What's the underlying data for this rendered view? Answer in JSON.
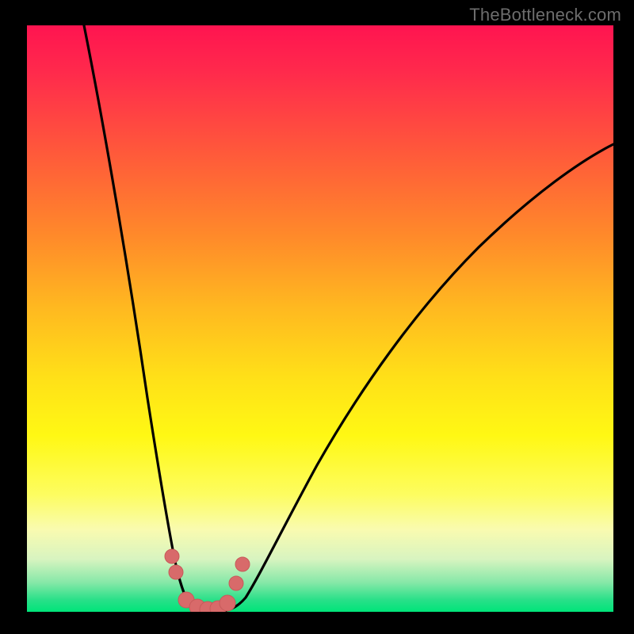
{
  "watermark": {
    "text": "TheBottleneck.com"
  },
  "colors": {
    "gradient_top": "#ff1450",
    "gradient_mid": "#ffe018",
    "gradient_bottom": "#00e47a",
    "curve_stroke": "#000000",
    "marker_fill": "#d86a6a",
    "marker_stroke": "#c75a5a"
  },
  "chart_data": {
    "type": "line",
    "title": "",
    "xlabel": "",
    "ylabel": "",
    "xlim": [
      0,
      100
    ],
    "ylim": [
      0,
      100
    ],
    "grid": false,
    "legend": false,
    "note": "Approximate V-shaped bottleneck curve. y is the vertical position (0 at bottom / green band, 100 at top / red). Minimum around x ≈ 27–34 where y ≈ 0.",
    "series": [
      {
        "name": "curve",
        "x": [
          10,
          12,
          14,
          16,
          18,
          20,
          22,
          24,
          26,
          27,
          30,
          32,
          34,
          36,
          40,
          45,
          50,
          55,
          60,
          65,
          70,
          75,
          80,
          85,
          90,
          95,
          100
        ],
        "y": [
          100,
          88,
          76,
          64,
          52,
          40,
          28,
          16,
          6,
          2,
          0,
          0,
          2,
          5,
          12,
          20,
          28,
          35,
          42,
          48,
          54,
          59,
          63,
          67,
          71,
          74,
          77
        ]
      }
    ],
    "markers": {
      "name": "highlighted-points",
      "note": "Salmon dots clustered near the valley of the curve",
      "x": [
        24.5,
        25.2,
        27.0,
        28.8,
        30.5,
        32.2,
        33.8,
        35.4,
        36.5
      ],
      "y": [
        9.0,
        6.5,
        1.8,
        0.8,
        0.5,
        0.6,
        1.6,
        5.0,
        8.2
      ]
    }
  }
}
